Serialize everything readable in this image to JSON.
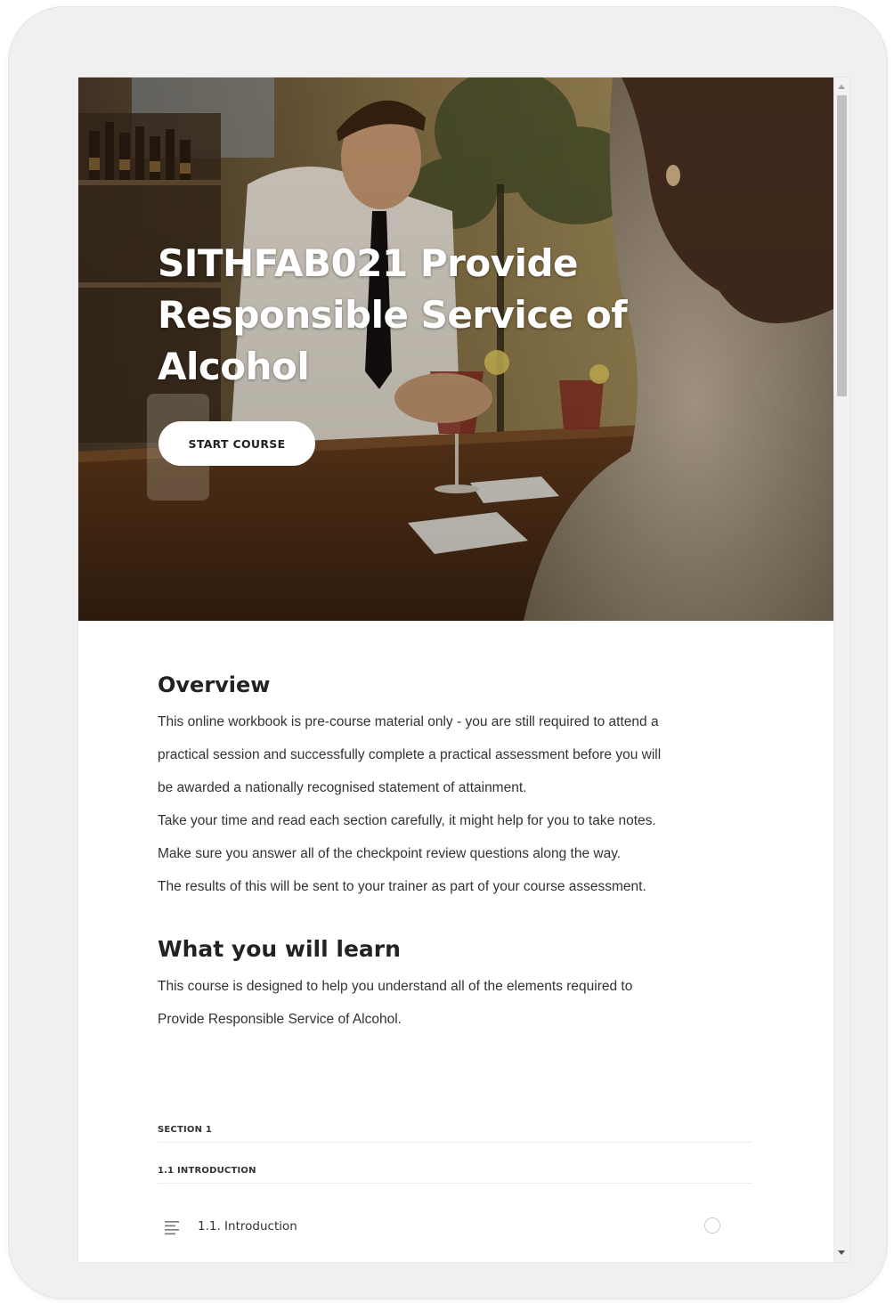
{
  "course": {
    "title": "SITHFAB021 Provide Responsible Service of Alcohol",
    "start_label": "START COURSE"
  },
  "overview": {
    "heading": "Overview",
    "lines": [
      "This online workbook is pre-course material only - you are still required to attend a",
      "practical session and successfully complete a practical assessment before you will",
      "be awarded a nationally recognised statement of attainment.",
      "Take your time and read each section carefully, it might help for you to take notes.",
      "Make sure you answer all of the checkpoint review questions along the way.",
      "The results of this will be sent to your trainer as part of your course assessment."
    ]
  },
  "learn": {
    "heading": "What you will learn",
    "lines": [
      "This course is designed to help you understand all of the elements required to",
      "Provide Responsible Service of Alcohol."
    ]
  },
  "outline": {
    "section_label": "SECTION 1",
    "subsection_label": "1.1 INTRODUCTION",
    "lesson_label": "1.1. Introduction",
    "lesson_icon": "text-lines-icon",
    "lesson_status": "incomplete"
  }
}
